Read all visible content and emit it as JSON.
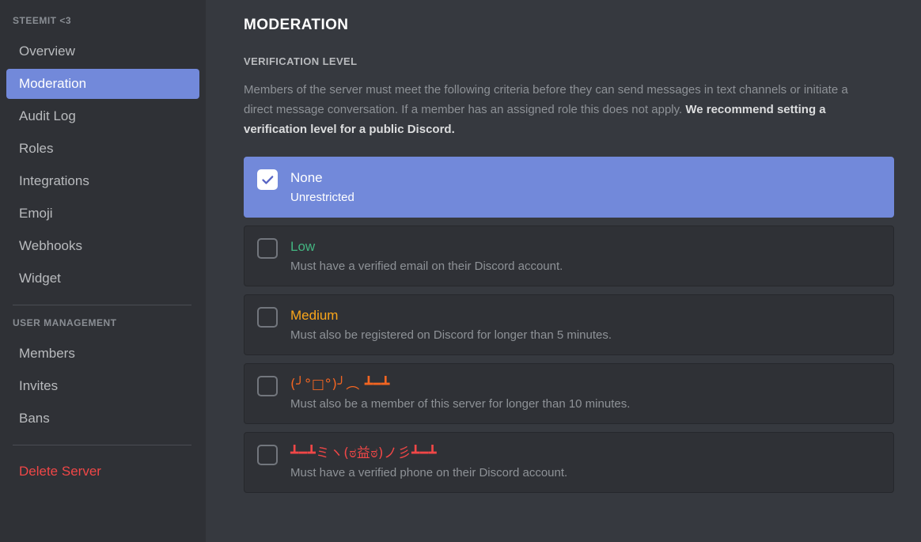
{
  "sidebar": {
    "server_header": "STEEMIT <3",
    "items": [
      {
        "label": "Overview",
        "active": false
      },
      {
        "label": "Moderation",
        "active": true
      },
      {
        "label": "Audit Log",
        "active": false
      },
      {
        "label": "Roles",
        "active": false
      },
      {
        "label": "Integrations",
        "active": false
      },
      {
        "label": "Emoji",
        "active": false
      },
      {
        "label": "Webhooks",
        "active": false
      },
      {
        "label": "Widget",
        "active": false
      }
    ],
    "user_management_header": "USER MANAGEMENT",
    "user_items": [
      {
        "label": "Members"
      },
      {
        "label": "Invites"
      },
      {
        "label": "Bans"
      }
    ],
    "delete_label": "Delete Server"
  },
  "main": {
    "title": "MODERATION",
    "section_label": "VERIFICATION LEVEL",
    "description_part1": "Members of the server must meet the following criteria before they can send messages in text channels or initiate a direct message conversation. If a member has an assigned role this does not apply. ",
    "description_bold": "We recommend setting a verification level for a public Discord.",
    "options": [
      {
        "title": "None",
        "desc": "Unrestricted",
        "color": "#ffffff",
        "selected": true
      },
      {
        "title": "Low",
        "desc": "Must have a verified email on their Discord account.",
        "color": "#43b581",
        "selected": false
      },
      {
        "title": "Medium",
        "desc": "Must also be registered on Discord for longer than 5 minutes.",
        "color": "#faa61a",
        "selected": false
      },
      {
        "title": "(╯°□°)╯︵ ┻━┻",
        "desc": "Must also be a member of this server for longer than 10 minutes.",
        "color": "#f26522",
        "selected": false
      },
      {
        "title": "┻━┻ミヽ(ಠ益ಠ)ノ彡┻━┻",
        "desc": "Must have a verified phone on their Discord account.",
        "color": "#f04747",
        "selected": false
      }
    ]
  },
  "colors": {
    "accent": "#7289da",
    "sidebar_bg": "#2f3136",
    "main_bg": "#36393f",
    "danger": "#f04747"
  }
}
